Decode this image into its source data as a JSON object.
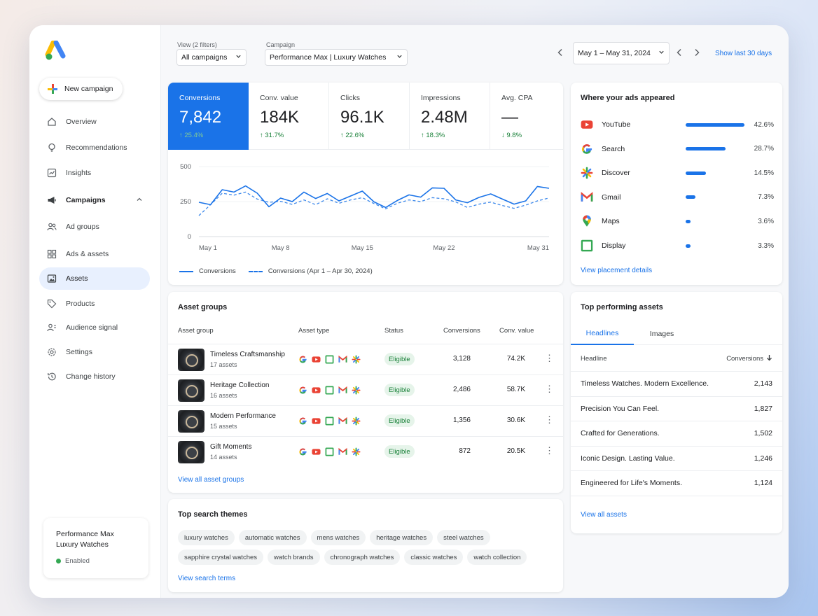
{
  "sidebar": {
    "new_campaign": "New campaign",
    "items": [
      {
        "label": "Overview",
        "icon": "home-icon"
      },
      {
        "label": "Recommendations",
        "icon": "lightbulb-icon"
      },
      {
        "label": "Insights",
        "icon": "insights-icon"
      },
      {
        "label": "Campaigns",
        "icon": "megaphone-icon"
      },
      {
        "label": "Ad groups",
        "icon": "people-icon"
      },
      {
        "label": "Ads & assets",
        "icon": "grid-icon"
      },
      {
        "label": "Assets",
        "icon": "image-icon"
      },
      {
        "label": "Products",
        "icon": "tag-icon"
      },
      {
        "label": "Audience signal",
        "icon": "audience-icon"
      },
      {
        "label": "Settings",
        "icon": "gear-icon"
      },
      {
        "label": "Change history",
        "icon": "history-icon"
      }
    ],
    "campaign_card": {
      "line1": "Performance Max",
      "line2": "Luxury Watches",
      "status": "Enabled"
    }
  },
  "topbar": {
    "view_label": "View (2 filters)",
    "view_value": "All campaigns",
    "campaign_label": "Campaign",
    "campaign_value": "Performance Max | Luxury Watches",
    "date_range": "May 1 – May 31, 2024",
    "show_last": "Show last 30 days"
  },
  "kpis": [
    {
      "label": "Conversions",
      "value": "7,842",
      "delta": "↑ 25.4%"
    },
    {
      "label": "Conv. value",
      "value": "184K",
      "delta": "↑ 31.7%"
    },
    {
      "label": "Clicks",
      "value": "96.1K",
      "delta": "↑ 22.6%"
    },
    {
      "label": "Impressions",
      "value": "2.48M",
      "delta": "↑ 18.3%"
    },
    {
      "label": "Avg. CPA",
      "value": "—",
      "delta": "↓ 9.8%"
    }
  ],
  "chart_data": {
    "type": "line",
    "x": [
      1,
      2,
      3,
      4,
      5,
      6,
      7,
      8,
      9,
      10,
      11,
      12,
      13,
      14,
      15,
      16,
      17,
      18,
      19,
      20,
      21,
      22,
      23,
      24,
      25,
      26,
      27,
      28,
      29,
      30,
      31
    ],
    "x_tick_labels": [
      "May 1",
      "May 8",
      "May 15",
      "May 22",
      "May 31"
    ],
    "x_tick_positions": [
      1,
      8,
      15,
      22,
      31
    ],
    "ylim": [
      0,
      500
    ],
    "y_ticks": [
      "500",
      "250",
      "0"
    ],
    "series": [
      {
        "name": "Conversions",
        "style": "solid",
        "color": "#1a73e8",
        "values": [
          245,
          228,
          335,
          318,
          362,
          310,
          213,
          275,
          250,
          318,
          272,
          308,
          255,
          290,
          325,
          248,
          208,
          258,
          298,
          282,
          348,
          345,
          262,
          242,
          280,
          305,
          268,
          232,
          255,
          358,
          345
        ]
      },
      {
        "name": "Conversions (Apr 1 – Apr 30, 2024)",
        "style": "dashed",
        "color": "#1a73e8",
        "values": [
          150,
          228,
          310,
          296,
          318,
          268,
          245,
          252,
          230,
          262,
          228,
          270,
          238,
          262,
          278,
          236,
          198,
          238,
          262,
          250,
          278,
          270,
          248,
          208,
          232,
          246,
          222,
          202,
          225,
          255,
          276
        ]
      }
    ]
  },
  "placements": {
    "title": "Where your ads appeared",
    "rows": [
      {
        "name": "YouTube",
        "pct": "42.6%",
        "value": 42.6,
        "icon": "youtube-icon"
      },
      {
        "name": "Search",
        "pct": "28.7%",
        "value": 28.7,
        "icon": "google-icon"
      },
      {
        "name": "Discover",
        "pct": "14.5%",
        "value": 14.5,
        "icon": "discover-icon"
      },
      {
        "name": "Gmail",
        "pct": "7.3%",
        "value": 7.3,
        "icon": "gmail-icon"
      },
      {
        "name": "Maps",
        "pct": "3.6%",
        "value": 3.6,
        "icon": "maps-icon"
      },
      {
        "name": "Display",
        "pct": "3.3%",
        "value": 3.3,
        "icon": "display-icon"
      }
    ],
    "link": "View placement details"
  },
  "asset_groups": {
    "title": "Asset groups",
    "headers": [
      "Asset group",
      "Asset type",
      "Status",
      "Conversions",
      "Conv. value"
    ],
    "rows": [
      {
        "name": "Timeless Craftsmanship",
        "sub": "17 assets",
        "status": "Eligible",
        "conv": "3,128",
        "value": "74.2K"
      },
      {
        "name": "Heritage Collection",
        "sub": "16 assets",
        "status": "Eligible",
        "conv": "2,486",
        "value": "58.7K"
      },
      {
        "name": "Modern Performance",
        "sub": "15 assets",
        "status": "Eligible",
        "conv": "1,356",
        "value": "30.6K"
      },
      {
        "name": "Gift Moments",
        "sub": "14 assets",
        "status": "Eligible",
        "conv": "872",
        "value": "20.5K"
      }
    ],
    "link": "View all asset groups"
  },
  "top_assets": {
    "title": "Top performing assets",
    "tabs": [
      "Headlines",
      "Images"
    ],
    "col1": "Headline",
    "col2": "Conversions",
    "rows": [
      {
        "headline": "Timeless Watches. Modern Excellence.",
        "conv": "2,143"
      },
      {
        "headline": "Precision You Can Feel.",
        "conv": "1,827"
      },
      {
        "headline": "Crafted for Generations.",
        "conv": "1,502"
      },
      {
        "headline": "Iconic Design. Lasting Value.",
        "conv": "1,246"
      },
      {
        "headline": "Engineered for Life's Moments.",
        "conv": "1,124"
      }
    ],
    "link": "View all assets"
  },
  "search_themes": {
    "title": "Top search themes",
    "row1": [
      "luxury watches",
      "automatic watches",
      "mens watches",
      "heritage watches",
      "steel watches"
    ],
    "row2": [
      "sapphire crystal watches",
      "watch brands",
      "chronograph watches",
      "classic watches",
      "watch collection"
    ],
    "link": "View search terms"
  }
}
